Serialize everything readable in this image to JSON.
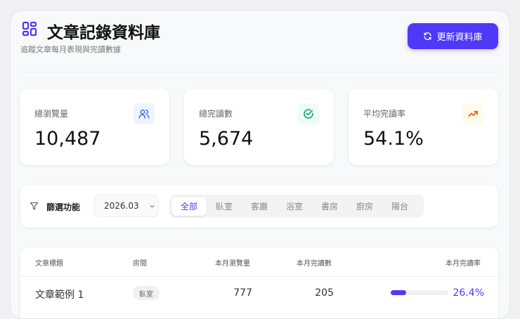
{
  "header": {
    "title": "文章記錄資料庫",
    "subtitle": "追蹤文章每月表現與完讀數據",
    "refresh_label": "更新資料庫"
  },
  "stats": [
    {
      "label": "總瀏覽量",
      "value": "10,487",
      "icon": "users-icon",
      "color": "#2563eb",
      "bg": "#eef3ff"
    },
    {
      "label": "總完讀數",
      "value": "5,674",
      "icon": "check-circle-icon",
      "color": "#059669",
      "bg": "#ecfdf3"
    },
    {
      "label": "平均完讀率",
      "value": "54.1%",
      "icon": "trending-up-icon",
      "color": "#ea580c",
      "bg": "#fffbeb"
    }
  ],
  "filter": {
    "label": "篩選功能",
    "month": "2026.03",
    "tabs": [
      "全部",
      "臥室",
      "客廳",
      "浴室",
      "書房",
      "廚房",
      "陽台"
    ],
    "active_tab": 0
  },
  "table": {
    "headers": [
      "文章標題",
      "房間",
      "本月瀏覽量",
      "本月完讀數",
      "本月完讀率"
    ],
    "rows": [
      {
        "title": "文章範例 1",
        "room": "臥室",
        "views": "777",
        "reads": "205",
        "rate": "26.4%",
        "rate_value": 26.4
      }
    ]
  },
  "colors": {
    "accent": "#4f39f6"
  }
}
